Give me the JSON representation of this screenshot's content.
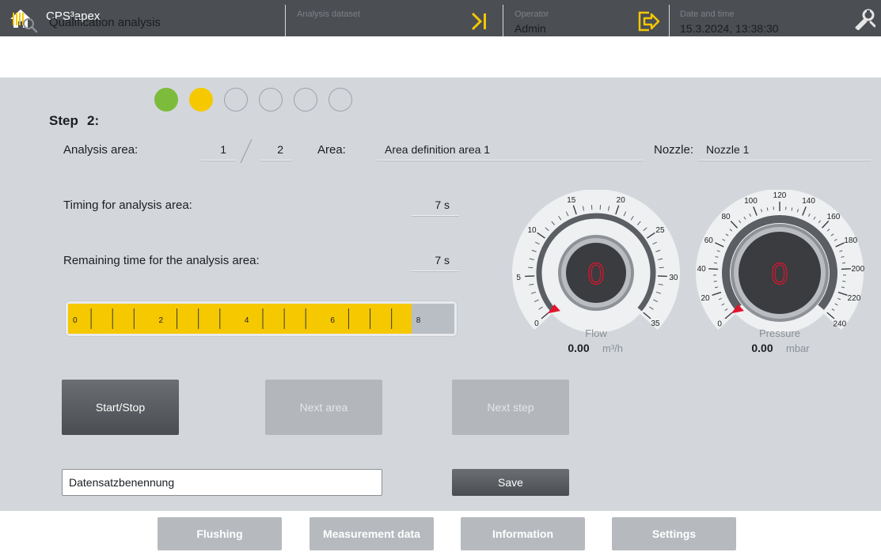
{
  "app": {
    "title": "CPS³apex"
  },
  "header": {
    "title": "Qualification analysis",
    "dataset_label": "Analysis dataset",
    "operator_label": "Operator",
    "operator_value": "Admin",
    "datetime_label": "Date and time",
    "datetime_value": "15.3.2024, 13:38:30"
  },
  "step": {
    "label": "Step",
    "value": "2:",
    "total_steps": 6,
    "dots": [
      "complete",
      "current",
      "pending",
      "pending",
      "pending",
      "pending"
    ],
    "colors": {
      "complete": "#7dbb3c",
      "current": "#f5c800",
      "pending": "#d3d7dc"
    }
  },
  "analysis_area": {
    "label": "Analysis area:",
    "current": "1",
    "total": "2",
    "area_label": "Area:",
    "area_value": "Area definition area 1",
    "nozzle_label": "Nozzle:",
    "nozzle_value": "Nozzle 1"
  },
  "timing": {
    "label": "Timing for analysis area:",
    "value": "7 s",
    "remaining_label": "Remaining time for the analysis area:",
    "remaining_value": "7 s"
  },
  "progress": {
    "max": 9,
    "value": 8,
    "tick_labels": [
      "0",
      "2",
      "4",
      "6",
      "8"
    ],
    "tick_label_values": [
      0,
      2,
      4,
      6,
      8
    ]
  },
  "gauges": {
    "flow": {
      "name": "Flow",
      "unit": "m³/h",
      "value_text": "0.00",
      "center_text": "0",
      "min": 0,
      "max": 35,
      "labels": [
        "0",
        "5",
        "10",
        "15",
        "20",
        "25",
        "30",
        "35"
      ],
      "label_values": [
        0,
        5,
        10,
        15,
        20,
        25,
        30,
        35
      ]
    },
    "pressure": {
      "name": "Pressure",
      "unit": "mbar",
      "value_text": "0.00",
      "center_text": "0",
      "min": 0,
      "max": 240,
      "labels": [
        "0",
        "20",
        "40",
        "60",
        "80",
        "100",
        "120",
        "140",
        "160",
        "180",
        "200",
        "220",
        "240"
      ],
      "label_values": [
        0,
        20,
        40,
        60,
        80,
        100,
        120,
        140,
        160,
        180,
        200,
        220,
        240
      ]
    }
  },
  "buttons": {
    "start_stop": "Start/Stop",
    "next_area": "Next area",
    "next_step": "Next step",
    "save": "Save"
  },
  "dataset_name": {
    "value": "Datensatzbenennung"
  },
  "tabs": [
    "Flushing",
    "Measurement data",
    "Information",
    "Settings"
  ],
  "colors": {
    "accent_yellow": "#f5c800",
    "complete_green": "#7dbb3c",
    "indicator_red": "#e0142d"
  }
}
